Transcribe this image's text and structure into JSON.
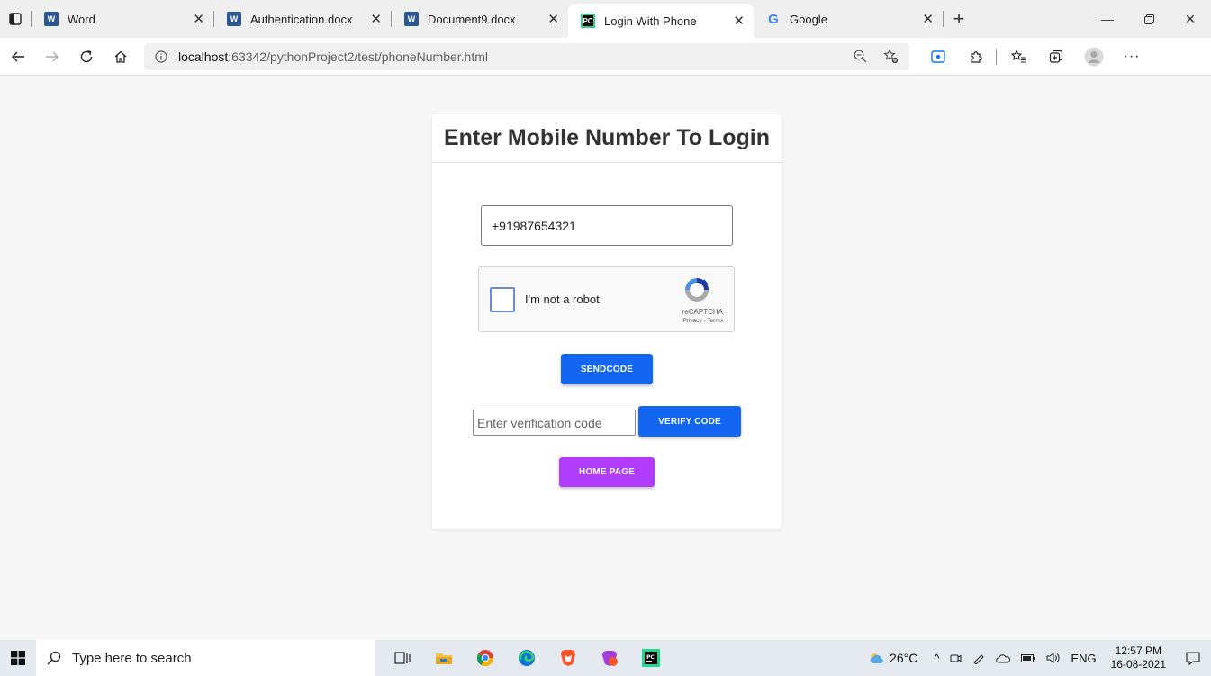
{
  "browser": {
    "tabs": [
      {
        "label": "Word",
        "icon": "word-icon",
        "active": false
      },
      {
        "label": "Authentication.docx",
        "icon": "word-icon",
        "active": false
      },
      {
        "label": "Document9.docx",
        "icon": "word-icon",
        "active": false
      },
      {
        "label": "Login With Phone",
        "icon": "pycharm-icon",
        "active": true
      },
      {
        "label": "Google",
        "icon": "google-icon",
        "active": false
      }
    ],
    "url_host": "localhost",
    "url_path": ":63342/pythonProject2/test/phoneNumber.html"
  },
  "page": {
    "title": "Enter Mobile Number To Login",
    "phone_value": "+91987654321",
    "recaptcha": {
      "label": "I'm not a robot",
      "brand": "reCAPTCHA",
      "links": "Privacy - Terms"
    },
    "send_button": "SENDCODE",
    "code_placeholder": "Enter verification code",
    "verify_button": "VERIFY CODE",
    "home_button": "HOME PAGE"
  },
  "taskbar": {
    "search_placeholder": "Type here to search",
    "weather": "26°C",
    "language": "ENG",
    "time": "12:57 PM",
    "date": "16-08-2021"
  },
  "colors": {
    "primary_button": "#1266f1",
    "home_button": "#b23cfd"
  }
}
